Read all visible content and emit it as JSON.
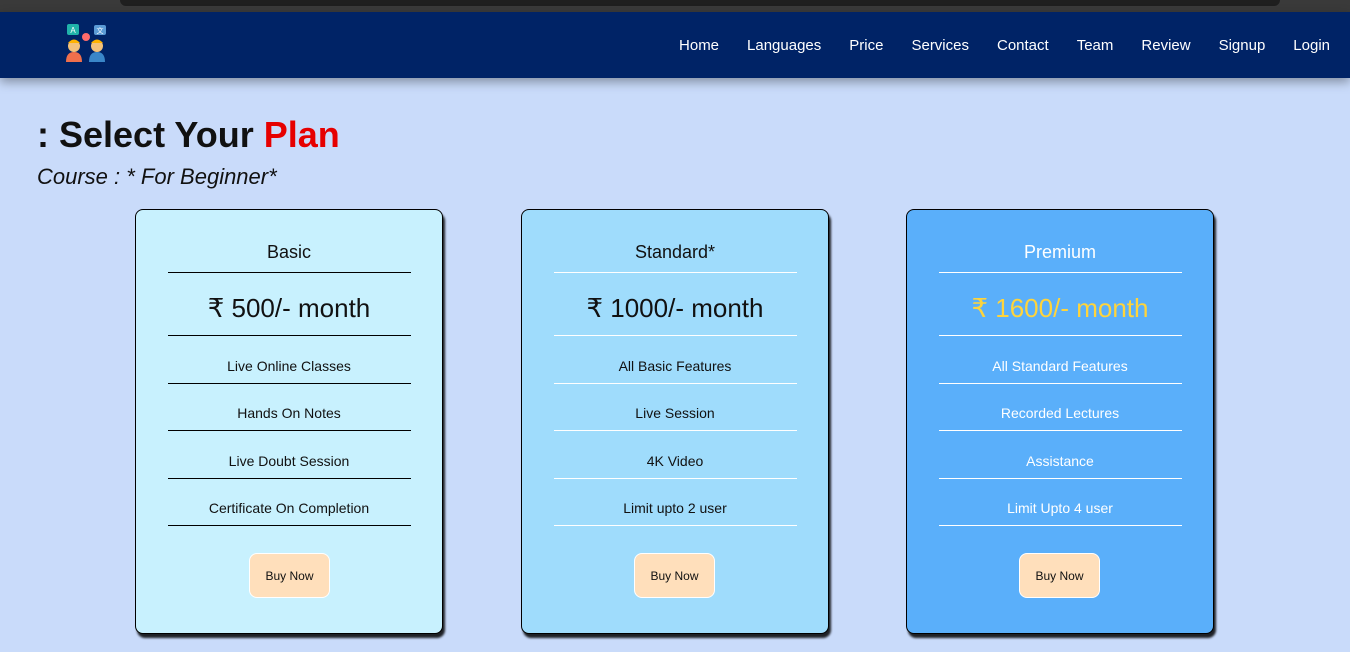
{
  "nav": {
    "logo_icon": "language-learners-logo",
    "links": [
      "Home",
      "Languages",
      "Price",
      "Services",
      "Contact",
      "Team",
      "Review",
      "Signup",
      "Login"
    ]
  },
  "heading": {
    "prefix": ": Select Your ",
    "accent": "Plan",
    "accent_color": "#e60000"
  },
  "subheading": "Course : * For Beginner*",
  "plans": [
    {
      "title": "Basic",
      "price": "₹ 500/- month",
      "features": [
        "Live Online Classes",
        "Hands On Notes",
        "Live Doubt Session",
        "Certificate On Completion"
      ],
      "button": "Buy Now",
      "bg_color": "#c8f1fe"
    },
    {
      "title": "Standard*",
      "price": "₹ 1000/- month",
      "features": [
        "All Basic Features",
        "Live Session",
        "4K Video",
        "Limit upto 2 user"
      ],
      "button": "Buy Now",
      "bg_color": "#9fdcfc"
    },
    {
      "title": "Premium",
      "price": "₹ 1600/- month",
      "features": [
        "All Standard Features",
        "Recorded Lectures",
        "Assistance",
        "Limit Upto 4 user"
      ],
      "button": "Buy Now",
      "bg_color": "#5aaffa",
      "price_color": "#ffd43b"
    }
  ],
  "colors": {
    "navbar": "#002366",
    "page_bg": "#c9dbfa",
    "button_bg": "#ffdfbb"
  }
}
